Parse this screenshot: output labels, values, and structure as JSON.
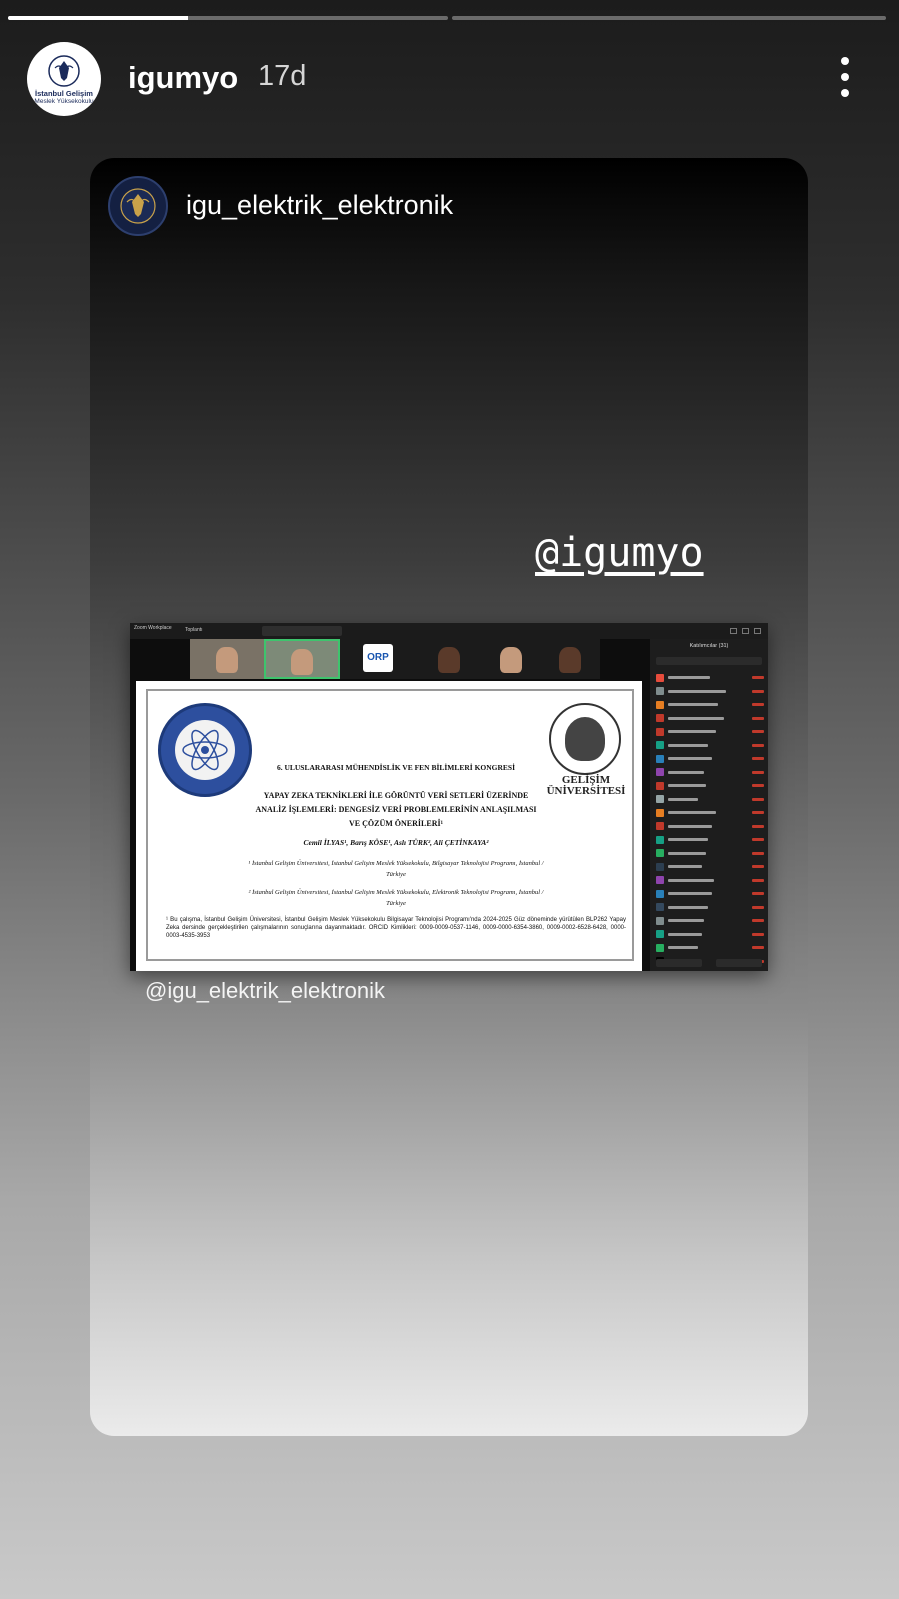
{
  "story": {
    "segments": [
      {
        "progress": 0.41
      },
      {
        "progress": 0.0
      }
    ],
    "author": {
      "username": "igumyo",
      "age": "17d",
      "avatar_text_line1": "İstanbul Gelişim",
      "avatar_text_line2": "Meslek Yüksekokulu"
    },
    "more_icon": "more-vertical-icon"
  },
  "shared_post": {
    "username": "igu_elektrik_elektronik",
    "mention_sticker": "@igumyo",
    "caption": "@igu_elektrik_elektronik",
    "screenshot": {
      "app_name": "Zoom Workplace",
      "tab_label": "Toplantı",
      "participant_tile_label": "ORP",
      "panel_title": "Katılımcılar (31)",
      "slide": {
        "congress": "6. ULUSLARARASI MÜHENDİSLİK VE FEN BİLİMLERİ KONGRESİ",
        "title": "YAPAY ZEKA TEKNİKLERİ İLE GÖRÜNTÜ VERİ SETLERİ ÜZERİNDE ANALİZ İŞLEMLERİ: DENGESİZ VERİ PROBLEMLERİNİN ANLAŞILMASI VE ÇÖZÜM ÖNERİLERİ¹",
        "authors": "Cemil İLYAS¹, Barış KÖSE¹, Aslı TÜRK², Ali ÇETİNKAYA²",
        "affiliation1": "¹ İstanbul Gelişim Üniversitesi, İstanbul Gelişim Meslek Yüksekokulu, Bilgisayar Teknolojisi Programı, İstanbul / Türkiye",
        "affiliation2": "² İstanbul Gelişim Üniversitesi, İstanbul Gelişim Meslek Yüksekokulu, Elektronik Teknolojisi Programı, İstanbul / Türkiye",
        "note": "¹ Bu çalışma, İstanbul Gelişim Üniversitesi, İstanbul Gelişim Meslek Yüksekokulu Bilgisayar Teknolojisi Programı'nda 2024-2025 Güz döneminde yürütülen BLP262 Yapay Zeka dersinde gerçekleştirilen çalışmalarının sonuçlarına dayanmaktadır. ORCID Kimlikleri: 0009-0009-0537-1146, 0009-0000-6354-3860, 0009-0002-6528-6428, 0000-0003-4535-3953",
        "university_name": "GELİŞİM ÜNİVERSİTESİ"
      }
    }
  }
}
